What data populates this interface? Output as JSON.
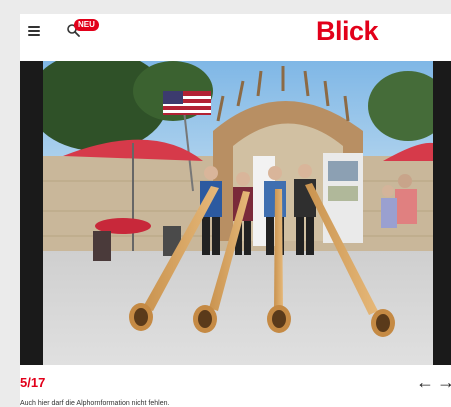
{
  "header": {
    "logo": "Blick",
    "badge": "NEU",
    "menu_icon": "hamburger-menu-icon",
    "search_icon": "search-icon"
  },
  "gallery": {
    "counter": "5/17",
    "caption": "Auch hier darf die Alphornformation nicht fehlen.",
    "prev_icon": "←",
    "next_icon": "→"
  },
  "colors": {
    "brand": "#e2001a",
    "background": "#ffffff",
    "gallery_bg": "#1a1a1a"
  }
}
